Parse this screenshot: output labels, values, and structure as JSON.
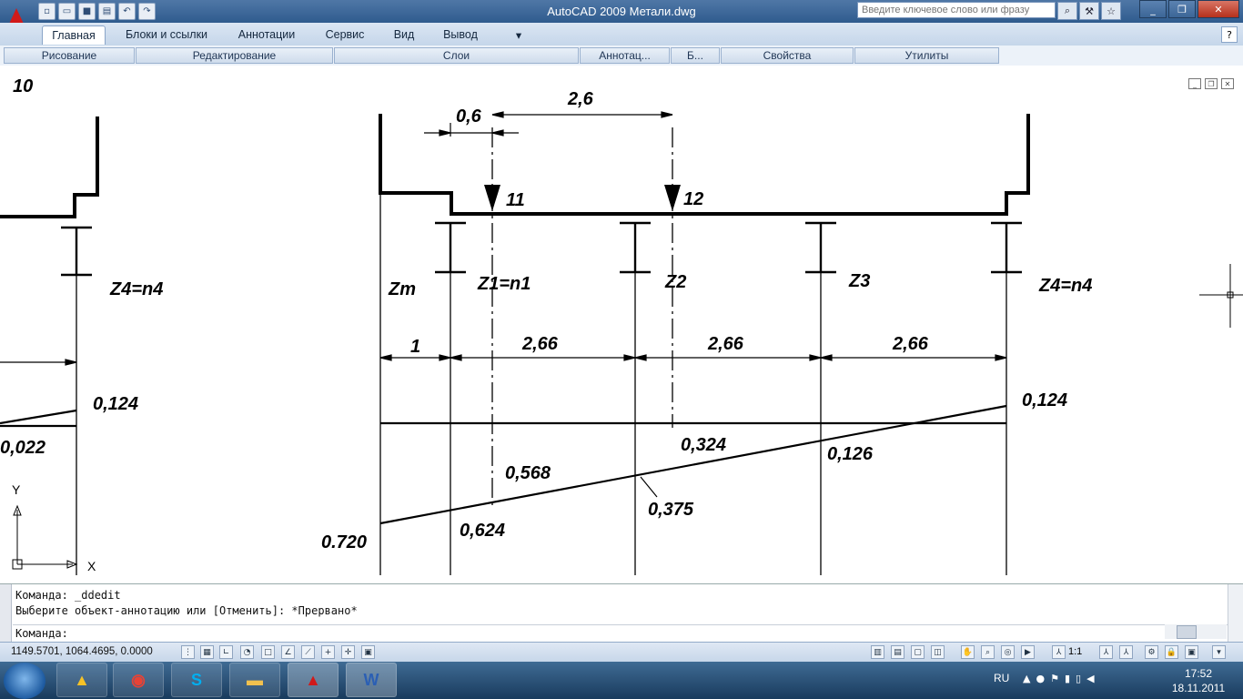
{
  "window": {
    "title": "AutoCAD 2009 Метали.dwg",
    "search_placeholder": "Введите ключевое слово или фразу",
    "controls": [
      "_",
      "❐",
      "✕"
    ]
  },
  "quick_access": [
    "new-icon",
    "open-icon",
    "save-icon",
    "print-icon",
    "undo-icon",
    "redo-icon"
  ],
  "ribbon": {
    "tabs": [
      "Главная",
      "Блоки и ссылки",
      "Аннотации",
      "Сервис",
      "Вид",
      "Вывод"
    ],
    "help": "?",
    "panels": [
      "Рисование",
      "Редактирование",
      "Слои",
      "Аннотац...",
      "Б...",
      "Свойства",
      "Утилиты"
    ]
  },
  "drawing": {
    "texts": [
      "10",
      "0,6",
      "2,6",
      "11",
      "12",
      "Zт",
      "Z1=n1",
      "Z2",
      "Z3",
      "Z4=n4",
      "Z4=n4",
      "1",
      "2,66",
      "2,66",
      "2,66",
      "0,124",
      "0,124",
      "0,022",
      "0,324",
      "0,126",
      "0,568",
      "0,375",
      "0,624",
      "0.720"
    ],
    "ucs": {
      "y": "Y",
      "x": "X"
    }
  },
  "command": {
    "line1": "Команда:  _ddedit",
    "line2": "Выберите объект-аннотацию или [Отменить]: *Прервано*",
    "prompt": "Команда:"
  },
  "status": {
    "coords": "1149.5701, 1064.4695, 0.0000",
    "scale": "1:1"
  },
  "taskbar": {
    "apps": [
      "autocad-launcher",
      "chrome",
      "skype",
      "explorer",
      "autocad",
      "word"
    ],
    "word_label": "W",
    "lang": "RU",
    "time": "17:52",
    "date": "18.11.2011"
  }
}
